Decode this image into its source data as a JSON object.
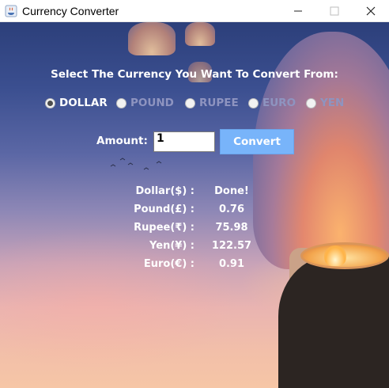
{
  "window": {
    "title": "Currency Converter",
    "controls": {
      "minimize": "minimize-icon",
      "maximize": "maximize-icon",
      "close": "close-icon"
    }
  },
  "form": {
    "heading": "Select The Currency You Want To Convert From:",
    "radios": [
      {
        "label": "DOLLAR",
        "selected": true
      },
      {
        "label": "POUND",
        "selected": false
      },
      {
        "label": "RUPEE",
        "selected": false
      },
      {
        "label": "EURO",
        "selected": false
      },
      {
        "label": "YEN",
        "selected": false
      }
    ],
    "amount_label": "Amount:",
    "amount_value": "1",
    "convert_label": "Convert"
  },
  "results": [
    {
      "label": "Dollar($) :",
      "value": "Done!"
    },
    {
      "label": "Pound(£) :",
      "value": "0.76"
    },
    {
      "label": "Rupee(₹) :",
      "value": "75.98"
    },
    {
      "label": "Yen(¥) :",
      "value": "122.57"
    },
    {
      "label": "Euro(€) :",
      "value": "0.91"
    }
  ],
  "colors": {
    "button_bg": "#78b4fa",
    "text": "#ffffff",
    "unselected_radio_text": "#8e94c0"
  }
}
